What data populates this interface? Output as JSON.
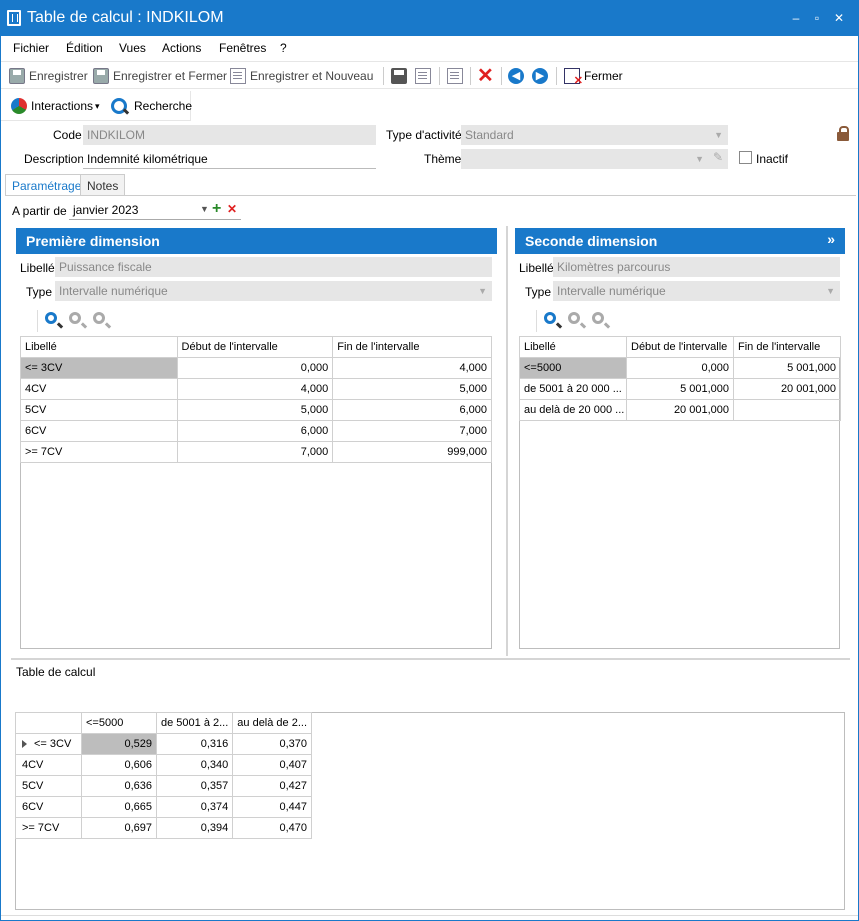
{
  "window": {
    "title": "Table de calcul : INDKILOM",
    "controls": {
      "minimize": "–",
      "maximize": "▫",
      "close": "✕"
    }
  },
  "menu": [
    "Fichier",
    "Édition",
    "Vues",
    "Actions",
    "Fenêtres",
    "?"
  ],
  "toolbar": {
    "save": "Enregistrer",
    "save_close": "Enregistrer et Fermer",
    "save_new": "Enregistrer et Nouveau",
    "close": "Fermer"
  },
  "toolbar2": {
    "interactions": "Interactions",
    "interactions_caret": "▾",
    "search": "Recherche"
  },
  "form": {
    "code_label": "Code",
    "code_value": "INDKILOM",
    "description_label": "Description",
    "description_value": "Indemnité kilométrique",
    "activity_label": "Type d'activité",
    "activity_value": "Standard",
    "theme_label": "Thème",
    "theme_value": "",
    "inactive_label": "Inactif"
  },
  "tabs": [
    "Paramétrage",
    "Notes"
  ],
  "from_label": "A partir de",
  "from_value": "janvier 2023",
  "first_dimension": {
    "title": "Première dimension",
    "libelle_label": "Libellé",
    "libelle_value": "Puissance fiscale",
    "type_label": "Type",
    "type_value": "Intervalle numérique",
    "columns": [
      "Libellé",
      "Début de l'intervalle",
      "Fin de l'intervalle"
    ],
    "rows": [
      [
        "<= 3CV",
        "0,000",
        "4,000"
      ],
      [
        "4CV",
        "4,000",
        "5,000"
      ],
      [
        "5CV",
        "5,000",
        "6,000"
      ],
      [
        "6CV",
        "6,000",
        "7,000"
      ],
      [
        ">= 7CV",
        "7,000",
        "999,000"
      ]
    ]
  },
  "second_dimension": {
    "title": "Seconde dimension",
    "expand_icon": "»",
    "libelle_label": "Libellé",
    "libelle_value": "Kilomètres parcourus",
    "type_label": "Type",
    "type_value": "Intervalle numérique",
    "columns": [
      "Libellé",
      "Début de l'intervalle",
      "Fin de l'intervalle"
    ],
    "rows": [
      [
        "<=5000",
        "0,000",
        "5 001,000"
      ],
      [
        "de 5001 à 20 000 ...",
        "5 001,000",
        "20 001,000"
      ],
      [
        "au delà de 20 000 ...",
        "20 001,000",
        ""
      ]
    ]
  },
  "calc_table": {
    "title": "Table de calcul",
    "columns": [
      "",
      "<=5000",
      "de 5001 à 2...",
      "au delà de 2..."
    ],
    "rows": [
      [
        "<= 3CV",
        "0,529",
        "0,316",
        "0,370"
      ],
      [
        "4CV",
        "0,606",
        "0,340",
        "0,407"
      ],
      [
        "5CV",
        "0,636",
        "0,357",
        "0,427"
      ],
      [
        "6CV",
        "0,665",
        "0,374",
        "0,447"
      ],
      [
        ">= 7CV",
        "0,697",
        "0,394",
        "0,470"
      ]
    ]
  },
  "icons": {
    "add": "+",
    "remove": "✕",
    "nav_prev": "◀",
    "nav_next": "▶",
    "delete": "✕",
    "caret": "▼",
    "pencil": "✎"
  },
  "colors": {
    "accent": "#1979ca",
    "delete": "#e02020",
    "add": "#2a8a2a"
  }
}
